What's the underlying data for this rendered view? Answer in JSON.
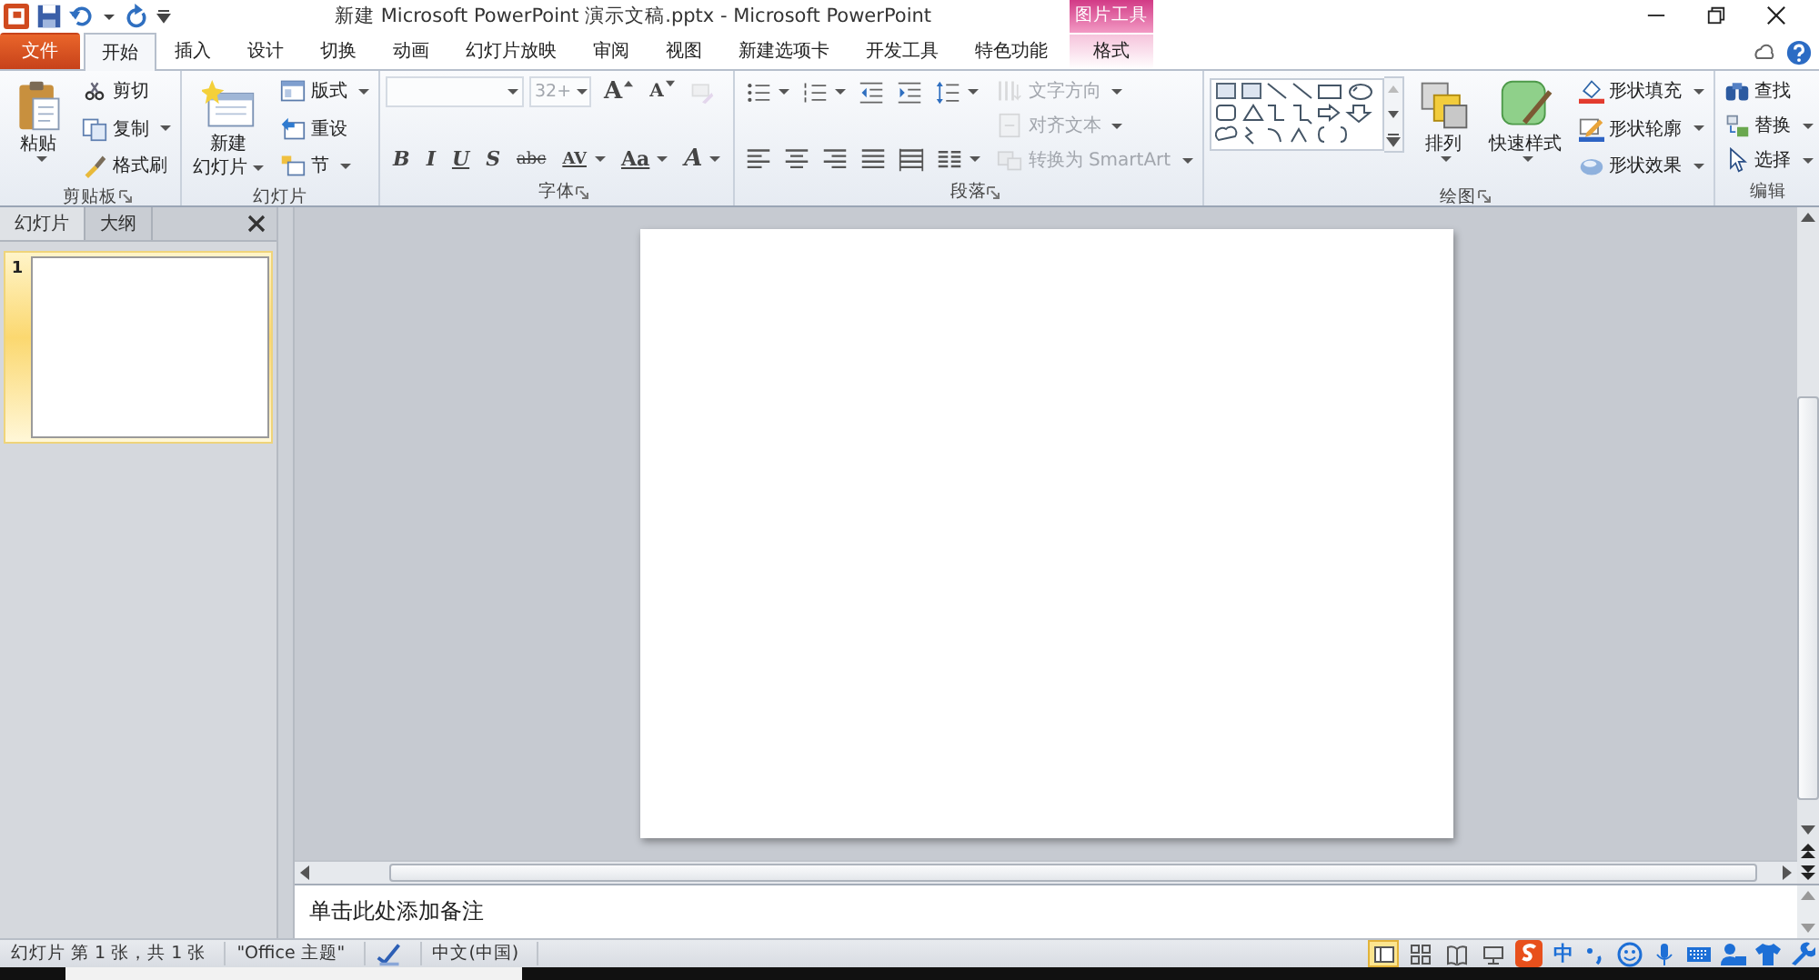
{
  "title_bar": {
    "title": "新建 Microsoft PowerPoint 演示文稿.pptx  -  Microsoft PowerPoint"
  },
  "tabs": [
    {
      "label": "文件",
      "kind": "file",
      "selected": false
    },
    {
      "label": "开始",
      "kind": "normal",
      "selected": true
    },
    {
      "label": "插入",
      "kind": "normal",
      "selected": false
    },
    {
      "label": "设计",
      "kind": "normal",
      "selected": false
    },
    {
      "label": "切换",
      "kind": "normal",
      "selected": false
    },
    {
      "label": "动画",
      "kind": "normal",
      "selected": false
    },
    {
      "label": "幻灯片放映",
      "kind": "normal",
      "selected": false
    },
    {
      "label": "审阅",
      "kind": "normal",
      "selected": false
    },
    {
      "label": "视图",
      "kind": "normal",
      "selected": false
    },
    {
      "label": "新建选项卡",
      "kind": "normal",
      "selected": false
    },
    {
      "label": "开发工具",
      "kind": "normal",
      "selected": false
    },
    {
      "label": "特色功能",
      "kind": "normal",
      "selected": false
    },
    {
      "label": "格式",
      "kind": "contextual",
      "context": "图片工具",
      "selected": false
    }
  ],
  "ribbon_groups": [
    {
      "label": "剪贴板",
      "launcher": true,
      "columns": [
        [
          [
            {
              "kind": "large",
              "label_lines": [
                "粘贴"
              ],
              "dropdown": true,
              "disabled": false
            }
          ]
        ],
        [
          [
            {
              "kind": "small",
              "label": "剪切",
              "dropdown": false,
              "disabled": false
            }
          ],
          [
            {
              "kind": "small",
              "label": "复制",
              "dropdown": true,
              "disabled": false
            }
          ],
          [
            {
              "kind": "small",
              "label": "格式刷",
              "dropdown": false,
              "disabled": false
            }
          ]
        ]
      ]
    },
    {
      "label": "幻灯片",
      "launcher": false,
      "columns": [
        [
          [
            {
              "kind": "large",
              "label_lines": [
                "新建",
                "幻灯片"
              ],
              "dropdown": true,
              "disabled": false
            }
          ]
        ],
        [
          [
            {
              "kind": "small",
              "label": "版式",
              "dropdown": true,
              "disabled": false
            }
          ],
          [
            {
              "kind": "small",
              "label": "重设",
              "dropdown": false,
              "disabled": false
            }
          ],
          [
            {
              "kind": "small",
              "label": "节",
              "dropdown": true,
              "disabled": false
            }
          ]
        ]
      ]
    },
    {
      "label": "字体",
      "launcher": true,
      "columns": [
        [
          [
            {
              "kind": "font-combo",
              "dropdown": true,
              "disabled": true
            },
            {
              "kind": "size-combo",
              "value": "32+",
              "dropdown": true,
              "disabled": true
            },
            {
              "kind": "grow",
              "label": "A",
              "dropdown": false,
              "disabled": false
            },
            {
              "kind": "shrink",
              "label": "A",
              "dropdown": false,
              "disabled": false
            },
            {
              "kind": "icon",
              "dropdown": false,
              "disabled": true
            }
          ],
          [
            {
              "kind": "glyph",
              "label": "B",
              "dropdown": false,
              "disabled": false
            },
            {
              "kind": "glyph",
              "label": "I",
              "dropdown": false,
              "disabled": false
            },
            {
              "kind": "glyph",
              "label": "U",
              "dropdown": false,
              "disabled": false
            },
            {
              "kind": "glyph",
              "label": "S",
              "dropdown": false,
              "disabled": false
            },
            {
              "kind": "glyph",
              "label": "abc",
              "dropdown": false,
              "disabled": false
            },
            {
              "kind": "glyph",
              "label": "AV",
              "dropdown": true,
              "disabled": false
            },
            {
              "kind": "glyph",
              "label": "Aa",
              "dropdown": true,
              "disabled": false
            },
            {
              "kind": "glyph",
              "label": "A",
              "dropdown": true,
              "disabled": false
            }
          ]
        ]
      ]
    },
    {
      "label": "段落",
      "launcher": true,
      "columns": [
        [
          [
            {
              "kind": "icon",
              "dropdown": true,
              "disabled": false
            },
            {
              "kind": "icon",
              "dropdown": true,
              "disabled": false
            },
            {
              "kind": "icon",
              "dropdown": false,
              "disabled": false
            },
            {
              "kind": "icon",
              "dropdown": false,
              "disabled": false
            },
            {
              "kind": "icon",
              "dropdown": true,
              "disabled": false
            }
          ],
          [
            {
              "kind": "icon",
              "dropdown": false,
              "disabled": false
            },
            {
              "kind": "icon",
              "dropdown": false,
              "disabled": false
            },
            {
              "kind": "icon",
              "dropdown": false,
              "disabled": false
            },
            {
              "kind": "icon",
              "dropdown": false,
              "disabled": false
            },
            {
              "kind": "icon",
              "dropdown": false,
              "disabled": false
            },
            {
              "kind": "icon",
              "dropdown": true,
              "disabled": false
            }
          ]
        ],
        [
          [
            {
              "kind": "small",
              "label": "文字方向",
              "dropdown": true,
              "disabled": true
            }
          ],
          [
            {
              "kind": "small",
              "label": "对齐文本",
              "dropdown": true,
              "disabled": true
            }
          ],
          [
            {
              "kind": "small",
              "label": "转换为 SmartArt",
              "dropdown": true,
              "disabled": true
            }
          ]
        ]
      ]
    },
    {
      "label": "绘图",
      "launcher": true,
      "columns": [
        [
          [
            {
              "kind": "gallery"
            }
          ]
        ],
        [
          [
            {
              "kind": "large",
              "label_lines": [
                "排列"
              ],
              "dropdown": true,
              "disabled": false
            }
          ]
        ],
        [
          [
            {
              "kind": "large",
              "label_lines": [
                "快速样式"
              ],
              "dropdown": true,
              "disabled": false
            }
          ]
        ],
        [
          [
            {
              "kind": "small",
              "label": "形状填充",
              "dropdown": true,
              "disabled": false
            }
          ],
          [
            {
              "kind": "small",
              "label": "形状轮廓",
              "dropdown": true,
              "disabled": false
            }
          ],
          [
            {
              "kind": "small",
              "label": "形状效果",
              "dropdown": true,
              "disabled": false
            }
          ]
        ]
      ]
    },
    {
      "label": "编辑",
      "launcher": false,
      "columns": [
        [
          [
            {
              "kind": "small",
              "label": "查找",
              "dropdown": false,
              "disabled": false
            }
          ],
          [
            {
              "kind": "small",
              "label": "替换",
              "dropdown": true,
              "disabled": false
            }
          ],
          [
            {
              "kind": "small",
              "label": "选择",
              "dropdown": true,
              "disabled": false
            }
          ]
        ]
      ]
    }
  ],
  "pane_tabs": [
    {
      "label": "幻灯片",
      "selected": true
    },
    {
      "label": "大纲",
      "selected": false
    }
  ],
  "thumbnails": [
    {
      "number": "1",
      "selected": true
    }
  ],
  "notes": {
    "prompt": "单击此处添加备注"
  },
  "status_bar": {
    "items": [
      {
        "kind": "text",
        "text": "幻灯片 第 1 张，共 1 张"
      },
      {
        "kind": "text",
        "text": "\"Office 主题\""
      },
      {
        "kind": "spellcheck"
      },
      {
        "kind": "text",
        "text": "中文(中国)"
      }
    ],
    "views": [
      {
        "selected": true
      },
      {
        "selected": false
      },
      {
        "selected": false
      },
      {
        "selected": false
      }
    ],
    "ime_mode": "中"
  }
}
